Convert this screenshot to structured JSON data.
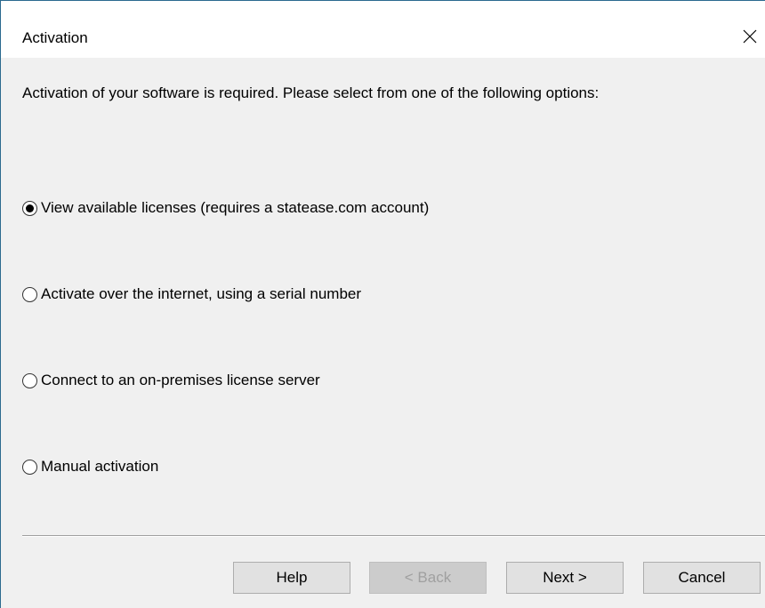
{
  "window": {
    "title": "Activation",
    "close_icon": "close-icon"
  },
  "instruction": "Activation of your software is required. Please select from one of the following options:",
  "options": [
    {
      "label": "View available licenses (requires a statease.com account)",
      "selected": true
    },
    {
      "label": "Activate over the internet, using a serial number",
      "selected": false
    },
    {
      "label": "Connect to an on-premises license server",
      "selected": false
    },
    {
      "label": "Manual activation",
      "selected": false
    }
  ],
  "buttons": {
    "help": "Help",
    "back": "< Back",
    "next": "Next >",
    "cancel": "Cancel"
  }
}
